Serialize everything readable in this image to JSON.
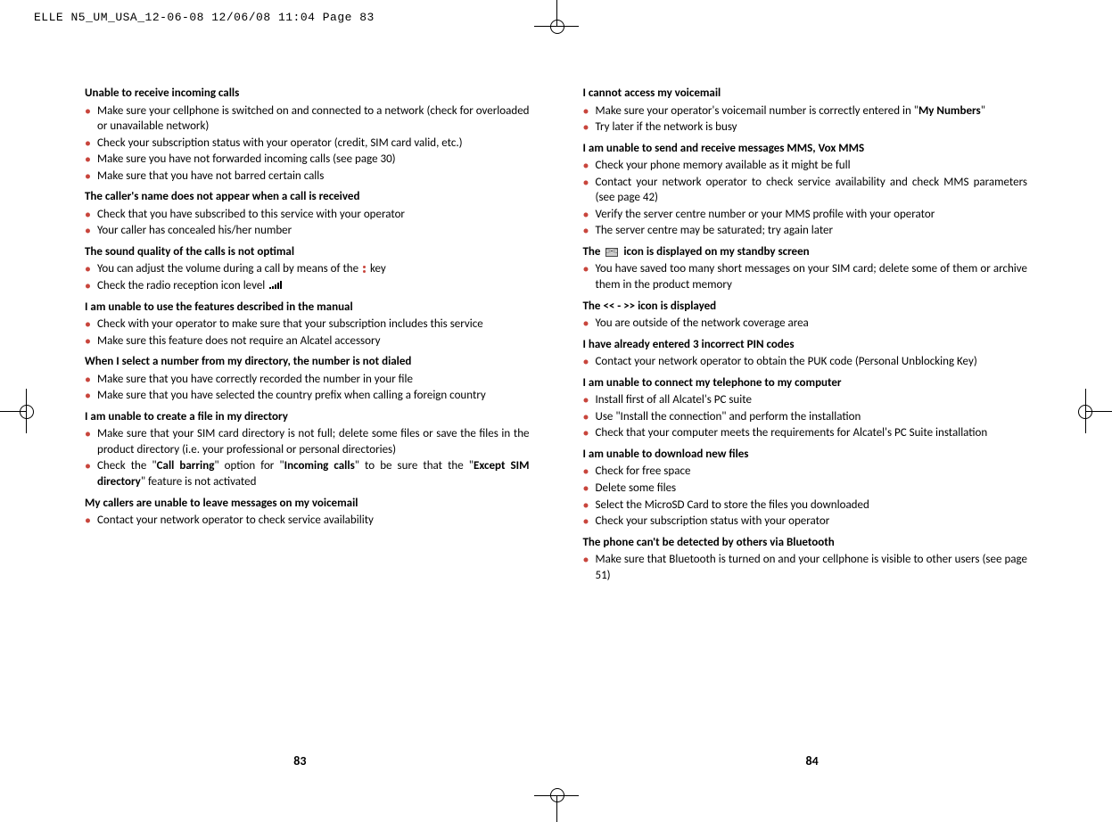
{
  "print_header": "ELLE N5_UM_USA_12-06-08  12/06/08  11:04  Page 83",
  "left": {
    "s1": {
      "title": "Unable to receive incoming calls",
      "items": [
        "Make sure your cellphone is switched on and connected to a network (check for overloaded or unavailable network)",
        "Check your subscription status with your operator (credit, SIM card valid, etc.)",
        "Make sure you have not forwarded incoming calls (see page 30)",
        "Make sure that you have not barred certain calls"
      ]
    },
    "s2": {
      "title": "The caller's name does not appear when a call is received",
      "items": [
        "Check that you have subscribed to this service with your operator",
        "Your caller has concealed his/her number"
      ]
    },
    "s3": {
      "title": "The sound quality of the calls is not optimal",
      "item1_pre": "You can adjust the volume during a call by means of the ",
      "item1_post": " key",
      "item2": "Check the radio reception icon level "
    },
    "s4": {
      "title": "I am unable to use the features described in the manual",
      "items": [
        "Check with your operator to make sure that your subscription includes this service",
        "Make sure this feature does not require an Alcatel accessory"
      ]
    },
    "s5": {
      "title": "When I select a number from my directory, the number is not dialed",
      "items": [
        "Make sure that you have correctly recorded the number in your file",
        "Make sure that you have selected the country prefix when calling a foreign country"
      ]
    },
    "s6": {
      "title": "I am unable to create a file in my directory",
      "item1": "Make sure that your SIM card directory is not full; delete some files or save the files in the product directory (i.e. your professional or personal directories)",
      "item2_a": "Check the \"",
      "item2_b": "Call barring",
      "item2_c": "\" option for \"",
      "item2_d": "Incoming calls",
      "item2_e": "\" to be sure that the \"",
      "item2_f": "Except SIM directory",
      "item2_g": "\" feature is not activated"
    },
    "s7": {
      "title": "My callers are unable to leave messages on my voicemail",
      "items": [
        "Contact your network operator to check service availability"
      ]
    },
    "page_number": "83"
  },
  "right": {
    "s1": {
      "title": "I cannot access my voicemail",
      "item1_a": "Make sure your operator's voicemail number is correctly entered in \"",
      "item1_b": "My Numbers",
      "item1_c": "\"",
      "item2": "Try later if the network is busy"
    },
    "s2": {
      "title": "I am unable to send and receive messages MMS, Vox MMS",
      "items": [
        "Check your phone memory available as it might be full",
        "Contact your network operator to check service availability and check MMS parameters (see page 42)",
        "Verify the server centre number or your MMS profile with your operator",
        "The server centre may be saturated; try again later"
      ]
    },
    "s3": {
      "title_pre": "The ",
      "title_post": " icon is displayed on my standby screen",
      "items": [
        "You have saved too many short messages on your SIM card; delete some of them or archive them in the product memory"
      ]
    },
    "s4": {
      "title": "The << - >> icon is displayed",
      "items": [
        "You are outside of the network coverage area"
      ]
    },
    "s5": {
      "title": "I have already entered 3 incorrect PIN codes",
      "items": [
        "Contact your network operator to obtain the PUK code (Personal Unblocking Key)"
      ]
    },
    "s6": {
      "title": "I am unable to connect my telephone to my computer",
      "items": [
        "Install first of all Alcatel's PC suite",
        "Use \"Install the connection\" and perform the installation",
        "Check that your computer meets the requirements for Alcatel's PC Suite installation"
      ]
    },
    "s7": {
      "title": "I am unable to download new files",
      "items": [
        "Check for free space",
        "Delete some files",
        "Select the MicroSD Card to store the files you downloaded",
        "Check your subscription status with your operator"
      ]
    },
    "s8": {
      "title": "The phone can't be detected by others via Bluetooth",
      "items": [
        "Make sure that Bluetooth is turned on and your cellphone is visible to other users (see page 51)"
      ]
    },
    "page_number": "84"
  }
}
